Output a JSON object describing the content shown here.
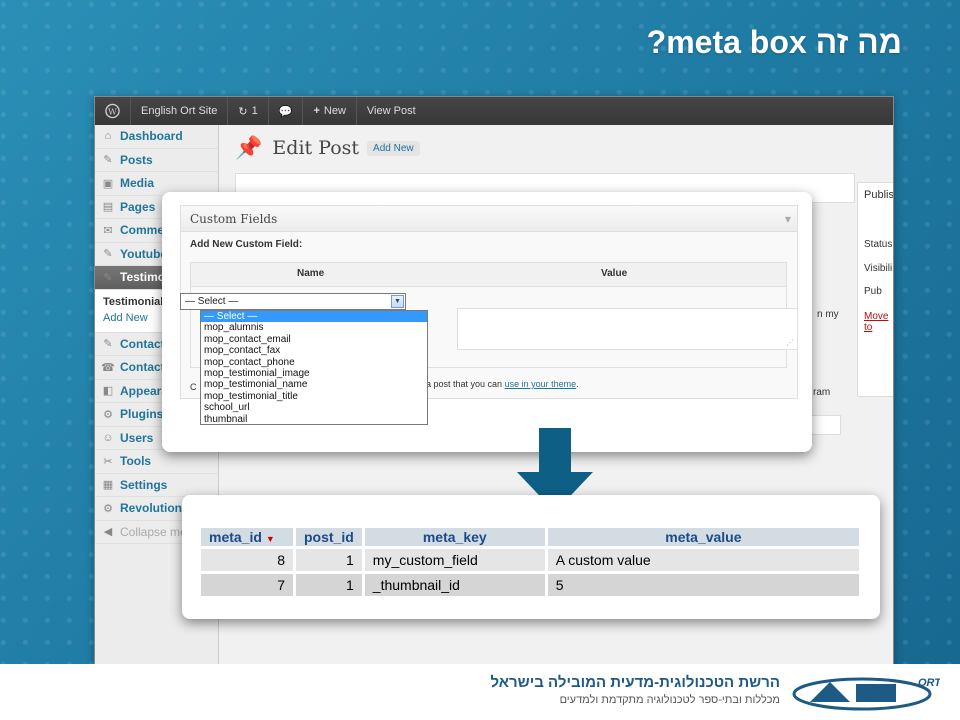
{
  "slide": {
    "title": "מה זה meta box?",
    "footer_line1": "הרשת הטכנולוגית-מדעית המובילה בישראל",
    "footer_line2": "מכללות ובתי-ספר לטכנולוגיה מתקדמת ולמדעים",
    "logo_text": "ORT"
  },
  "wp": {
    "adminbar": {
      "site_name": "English Ort Site",
      "updates_count": "1",
      "new_label": "New",
      "view_post": "View Post"
    },
    "sidebar": {
      "items": [
        {
          "label": "Dashboard",
          "icon": "dashboard-icon",
          "glyph": "⌂"
        },
        {
          "label": "Posts",
          "icon": "pin-icon",
          "glyph": "✎"
        },
        {
          "label": "Media",
          "icon": "media-icon",
          "glyph": "▣"
        },
        {
          "label": "Pages",
          "icon": "pages-icon",
          "glyph": "▤"
        },
        {
          "label": "Comme",
          "icon": "comments-icon",
          "glyph": "✉"
        },
        {
          "label": "Youtube",
          "icon": "pin-icon",
          "glyph": "✎"
        },
        {
          "label": "Testimo",
          "icon": "pin-icon",
          "glyph": "✎"
        }
      ],
      "submenu": [
        "Testimonial",
        "Add New"
      ],
      "items2": [
        {
          "label": "Contacts",
          "icon": "pin-icon",
          "glyph": "✎"
        },
        {
          "label": "Contact",
          "icon": "contact-icon",
          "glyph": "☎"
        },
        {
          "label": "Appeara",
          "icon": "appearance-icon",
          "glyph": "◧"
        },
        {
          "label": "Plugins",
          "icon": "plugins-icon",
          "glyph": "⚙"
        },
        {
          "label": "Users",
          "icon": "users-icon",
          "glyph": "☺"
        },
        {
          "label": "Tools",
          "icon": "tools-icon",
          "glyph": "✂"
        },
        {
          "label": "Settings",
          "icon": "settings-icon",
          "glyph": "▦"
        },
        {
          "label": "Revolution",
          "icon": "revolution-icon",
          "glyph": "⚙"
        }
      ],
      "collapse": "Collapse me"
    },
    "main": {
      "title": "Edit Post",
      "add_new": "Add New",
      "publish_label": "Publis",
      "status_label": "Status:",
      "visibility_label": "Visibili",
      "pub_label": "Pub",
      "move_to": "Move to",
      "partial_my": "n my",
      "partial_am": "ram"
    }
  },
  "custom_fields": {
    "title": "Custom Fields",
    "add_new_label": "Add New Custom Field:",
    "col_name": "Name",
    "col_value": "Value",
    "select_value": "— Select —",
    "options": [
      "— Select —",
      "mop_alumnis",
      "mop_contact_email",
      "mop_contact_fax",
      "mop_contact_phone",
      "mop_testimonial_image",
      "mop_testimonial_name",
      "mop_testimonial_title",
      "school_url",
      "thumbnail"
    ],
    "note_start": "C",
    "note_text": "a post that you can",
    "note_link": "use in your theme",
    "note_end": "."
  },
  "db_table": {
    "columns": [
      "meta_id",
      "post_id",
      "meta_key",
      "meta_value"
    ],
    "rows": [
      {
        "meta_id": "8",
        "post_id": "1",
        "meta_key": "my_custom_field",
        "meta_value": "A custom value"
      },
      {
        "meta_id": "7",
        "post_id": "1",
        "meta_key": "_thumbnail_id",
        "meta_value": "5"
      }
    ]
  }
}
